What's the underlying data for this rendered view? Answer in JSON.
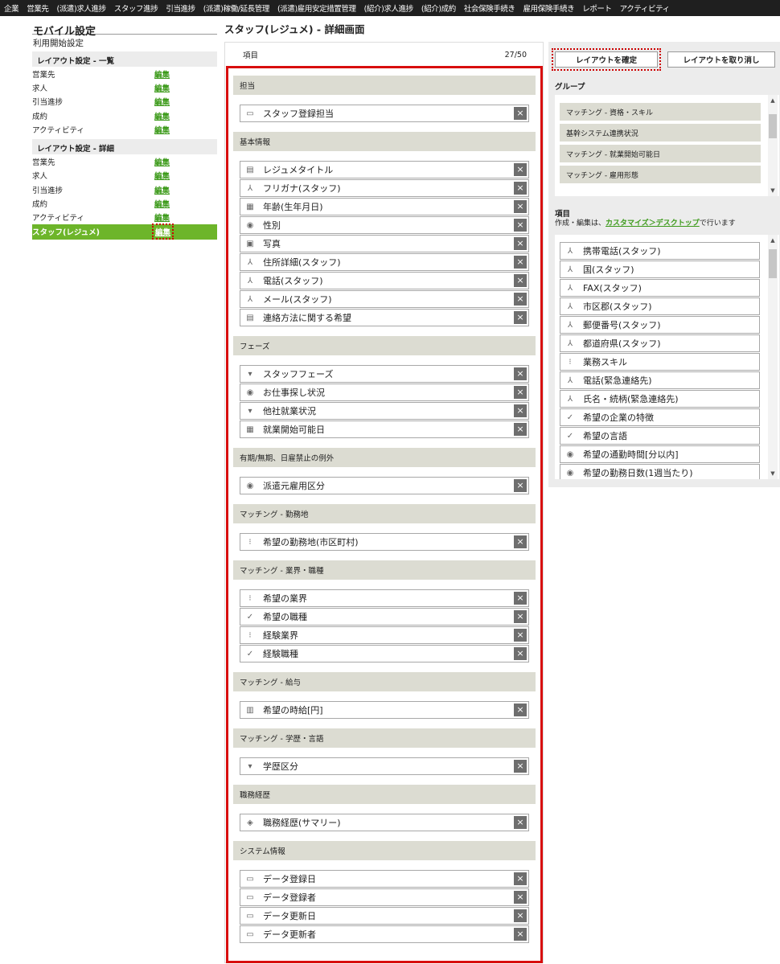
{
  "topnav": [
    "企業",
    "営業先",
    "(派遣)求人進捗",
    "スタッフ進捗",
    "引当進捗",
    "(派遣)稼働/延長管理",
    "(派遣)雇用安定措置管理",
    "(紹介)求人進捗",
    "(紹介)成約",
    "社会保険手続き",
    "雇用保険手続き",
    "レポート",
    "アクティビティ"
  ],
  "left": {
    "title": "モバイル設定",
    "start": "利用開始設定",
    "list_section": "レイアウト設定 - 一覧",
    "list_items": [
      {
        "label": "営業先",
        "edit": "編集"
      },
      {
        "label": "求人",
        "edit": "編集"
      },
      {
        "label": "引当進捗",
        "edit": "編集"
      },
      {
        "label": "成約",
        "edit": "編集"
      },
      {
        "label": "アクティビティ",
        "edit": "編集"
      }
    ],
    "detail_section": "レイアウト設定 - 詳細",
    "detail_items": [
      {
        "label": "営業先",
        "edit": "編集"
      },
      {
        "label": "求人",
        "edit": "編集"
      },
      {
        "label": "引当進捗",
        "edit": "編集"
      },
      {
        "label": "成約",
        "edit": "編集"
      },
      {
        "label": "アクティビティ",
        "edit": "編集"
      }
    ],
    "active_item": {
      "label": "スタッフ(レジュメ)",
      "edit": "編集"
    }
  },
  "page_title": "スタッフ(レジュメ) - 詳細画面",
  "panel": {
    "header_label": "項目",
    "count": "27/50",
    "groups": [
      {
        "name": "担当",
        "items": [
          {
            "icon": "monitor-icon",
            "label": "スタッフ登録担当"
          }
        ]
      },
      {
        "name": "基本情報",
        "items": [
          {
            "icon": "document-icon",
            "label": "レジュメタイトル"
          },
          {
            "icon": "person-icon",
            "label": "フリガナ(スタッフ)"
          },
          {
            "icon": "calendar-icon",
            "label": "年齢(生年月日)"
          },
          {
            "icon": "radio-icon",
            "label": "性別"
          },
          {
            "icon": "image-icon",
            "label": "写真"
          },
          {
            "icon": "person-icon",
            "label": "住所詳細(スタッフ)"
          },
          {
            "icon": "person-icon",
            "label": "電話(スタッフ)"
          },
          {
            "icon": "person-icon",
            "label": "メール(スタッフ)"
          },
          {
            "icon": "document-icon",
            "label": "連絡方法に関する希望"
          }
        ]
      },
      {
        "name": "フェーズ",
        "items": [
          {
            "icon": "dropdown-icon",
            "label": "スタッフフェーズ"
          },
          {
            "icon": "radio-icon",
            "label": "お仕事探し状況"
          },
          {
            "icon": "dropdown-icon",
            "label": "他社就業状況"
          },
          {
            "icon": "calendar-icon",
            "label": "就業開始可能日"
          }
        ]
      },
      {
        "name": "有期/無期、日雇禁止の例外",
        "items": [
          {
            "icon": "radio-icon",
            "label": "派遣元雇用区分"
          }
        ]
      },
      {
        "name": "マッチング - 勤務地",
        "items": [
          {
            "icon": "search-list-icon",
            "label": "希望の勤務地(市区町村)"
          }
        ]
      },
      {
        "name": "マッチング - 業界・職種",
        "items": [
          {
            "icon": "search-list-icon",
            "label": "希望の業界"
          },
          {
            "icon": "checkbox-icon",
            "label": "希望の職種"
          },
          {
            "icon": "search-list-icon",
            "label": "経験業界"
          },
          {
            "icon": "checkbox-icon",
            "label": "経験職種"
          }
        ]
      },
      {
        "name": "マッチング - 給与",
        "items": [
          {
            "icon": "currency-icon",
            "label": "希望の時給[円]"
          }
        ]
      },
      {
        "name": "マッチング - 学歴・言語",
        "items": [
          {
            "icon": "dropdown-icon",
            "label": "学歴区分"
          }
        ]
      },
      {
        "name": "職務経歴",
        "items": [
          {
            "icon": "career-icon",
            "label": "職務経歴(サマリー)"
          }
        ]
      },
      {
        "name": "システム情報",
        "items": [
          {
            "icon": "monitor-icon",
            "label": "データ登録日"
          },
          {
            "icon": "monitor-icon",
            "label": "データ登録者"
          },
          {
            "icon": "monitor-icon",
            "label": "データ更新日"
          },
          {
            "icon": "monitor-icon",
            "label": "データ更新者"
          }
        ]
      }
    ]
  },
  "right": {
    "confirm": "レイアウトを確定",
    "cancel": "レイアウトを取り消し",
    "group_label": "グループ",
    "groups": [
      "マッチング - 資格・スキル",
      "基幹システム連携状況",
      "マッチング - 就業開始可能日",
      "マッチング - 雇用形態"
    ],
    "items_label": "項目",
    "note_prefix": "作成・編集は、",
    "note_link": "カスタマイズ＞デスクトップ",
    "note_suffix": "で行います",
    "items": [
      {
        "icon": "person-icon",
        "label": "携帯電話(スタッフ)"
      },
      {
        "icon": "person-icon",
        "label": "国(スタッフ)"
      },
      {
        "icon": "person-icon",
        "label": "FAX(スタッフ)"
      },
      {
        "icon": "person-icon",
        "label": "市区郡(スタッフ)"
      },
      {
        "icon": "person-icon",
        "label": "郵便番号(スタッフ)"
      },
      {
        "icon": "person-icon",
        "label": "都道府県(スタッフ)"
      },
      {
        "icon": "search-list-icon",
        "label": "業務スキル"
      },
      {
        "icon": "person-icon",
        "label": "電話(緊急連絡先)"
      },
      {
        "icon": "person-icon",
        "label": "氏名・続柄(緊急連絡先)"
      },
      {
        "icon": "checkbox-icon",
        "label": "希望の企業の特徴"
      },
      {
        "icon": "checkbox-icon",
        "label": "希望の言語"
      },
      {
        "icon": "radio-icon",
        "label": "希望の通勤時間[分以内]"
      },
      {
        "icon": "radio-icon",
        "label": "希望の勤務日数(1週当たり)"
      }
    ]
  }
}
